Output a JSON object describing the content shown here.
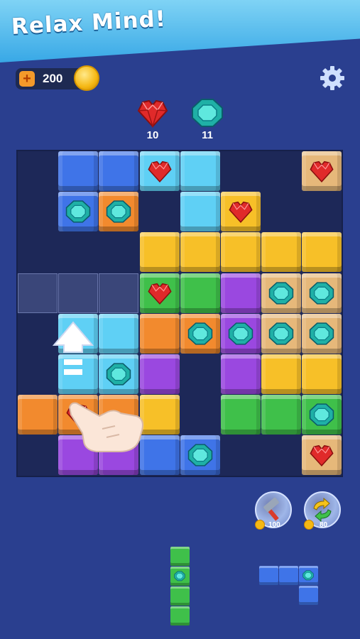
{
  "header": {
    "title": "Relax Mind!"
  },
  "currency": {
    "coins": "200",
    "add_label": "+"
  },
  "settings": {
    "icon": "gear-icon"
  },
  "targets": [
    {
      "gem": "red-heart-gem-icon",
      "count": "10"
    },
    {
      "gem": "teal-octagon-gem-icon",
      "count": "11"
    }
  ],
  "colors": {
    "B": "#3f74e8",
    "L": "#5fd0f5",
    "O": "#f28a2e",
    "Y": "#f7c028",
    "G": "#3fc04a",
    "P": "#9a48e0",
    "T": "#e6b87a"
  },
  "board": {
    "rows": [
      [
        "",
        "B",
        "B",
        "Lr",
        "L",
        "",
        "",
        "Tr"
      ],
      [
        "",
        "Bt",
        "Ot",
        "",
        "L",
        "Yr",
        "",
        ""
      ],
      [
        "",
        "",
        "",
        "Y",
        "Y",
        "Y",
        "Y",
        "Y"
      ],
      [
        "X",
        "X",
        "X",
        "Gr",
        "G",
        "P",
        "Tt",
        "Tt"
      ],
      [
        "",
        "L",
        "L",
        "O",
        "Ot",
        "Pt",
        "Tt",
        "Tt"
      ],
      [
        "",
        "L",
        "Lt",
        "P",
        "",
        "P",
        "Y",
        "Y"
      ],
      [
        "O",
        "Or",
        "O",
        "Y",
        "",
        "G",
        "G",
        "Gt"
      ],
      [
        "",
        "P",
        "P",
        "B",
        "Bt",
        "",
        "",
        "Tr"
      ]
    ]
  },
  "boosters": [
    {
      "name": "hammer-icon",
      "price": "100"
    },
    {
      "name": "swap-icon",
      "price": "80"
    }
  ],
  "pieces": [
    {
      "name": "vertical-green-piece",
      "color": "G"
    },
    {
      "name": "l-blue-piece",
      "color": "B"
    }
  ]
}
